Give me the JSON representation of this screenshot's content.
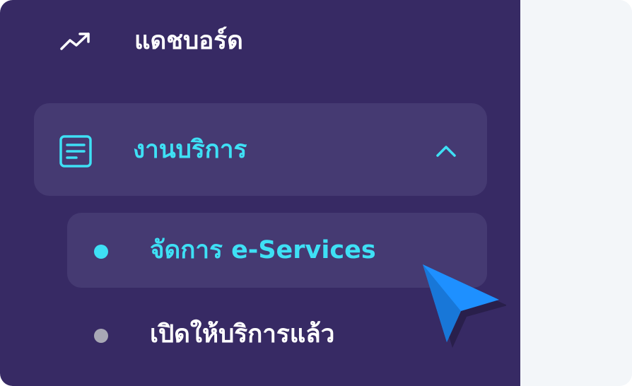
{
  "sidebar": {
    "dashboard": {
      "label": "แดชบอร์ด",
      "icon": "trending-up-icon"
    },
    "services_group": {
      "label": "งานบริการ",
      "icon": "document-list-icon",
      "expanded": true,
      "chevron_icon": "chevron-up-icon",
      "items": [
        {
          "label": "จัดการ e-Services",
          "active": true
        },
        {
          "label": "เปิดให้บริการแล้ว",
          "active": false
        }
      ]
    }
  },
  "colors": {
    "sidebar_bg": "#372a64",
    "highlight_bg": "#453a72",
    "accent": "#3ee0f5",
    "text_primary": "#ffffff",
    "inactive_dot": "#a8a8b5",
    "content_bg": "#f3f6f9",
    "cursor": "#1e90ff"
  },
  "cursor": {
    "icon": "mouse-pointer-icon"
  }
}
